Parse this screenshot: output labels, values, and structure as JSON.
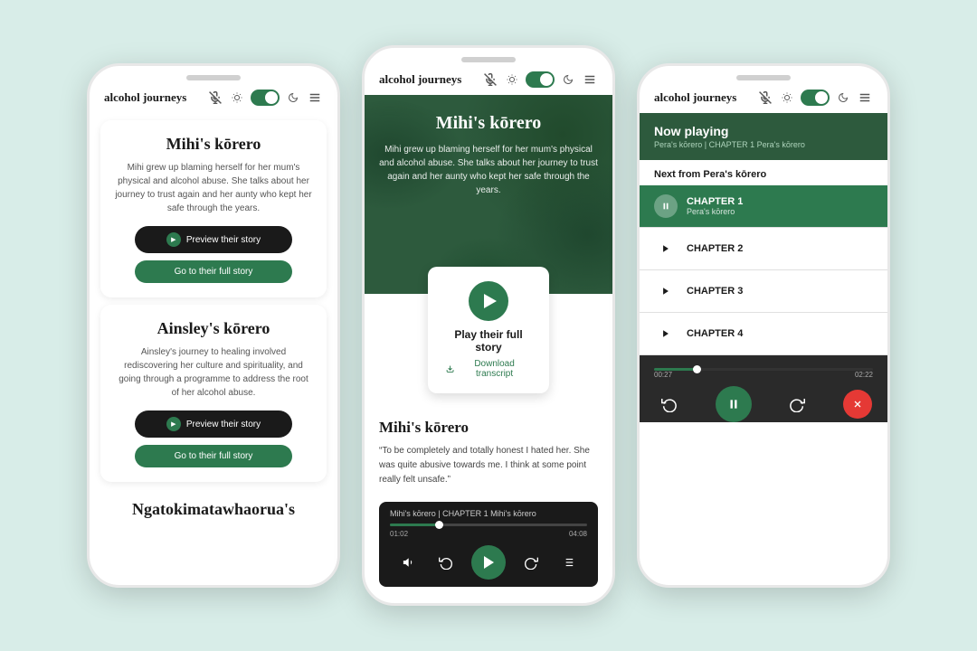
{
  "app": {
    "brand": "alcohol\njourneys",
    "toggle_on": true
  },
  "phone1": {
    "header": {
      "brand": "alcohol\njourneys"
    },
    "cards": [
      {
        "title": "Mihi's kōrero",
        "description": "Mihi grew up blaming herself for her mum's physical and alcohol abuse. She talks about her journey to trust again and her aunty who kept her safe through the years.",
        "btn_preview": "Preview their story",
        "btn_full": "Go to their full story"
      },
      {
        "title": "Ainsley's kōrero",
        "description": "Ainsley's journey to healing involved rediscovering her culture and spirituality, and going through a programme to address the root of her alcohol abuse.",
        "btn_preview": "Preview their story",
        "btn_full": "Go to their full story"
      }
    ],
    "partial_title": "Ngatokimatawhaorua's"
  },
  "phone2": {
    "header": {
      "brand": "alcohol\njourneys"
    },
    "hero": {
      "title": "Mihi's kōrero",
      "description": "Mihi grew up blaming herself for her mum's physical and alcohol abuse. She talks about her journey to trust again and her aunty who kept her safe through the years."
    },
    "play_card": {
      "title": "Play their full story",
      "download": "Download transcript"
    },
    "section": {
      "title": "Mihi's kōrero",
      "quote": "“To be completely and totally honest I hated her. She was quite abusive towards me. I think at some point really felt unsafe.”"
    },
    "player": {
      "track": "Mihi's kōrero | CHAPTER 1 Mihi's kōrero",
      "time_current": "01:02",
      "time_total": "04:08",
      "progress_pct": 25
    }
  },
  "phone3": {
    "header": {
      "brand": "alcohol\njourneys"
    },
    "now_playing": {
      "label": "Now playing",
      "track": "Pera's kōrero | CHAPTER 1 Pera's kōrero"
    },
    "next_label": "Next from Pera's kōrero",
    "chapters": [
      {
        "id": 1,
        "label": "CHAPTER 1",
        "sublabel": "Pera's kōrero",
        "active": true,
        "icon": "pause"
      },
      {
        "id": 2,
        "label": "CHAPTER 2",
        "sublabel": "",
        "active": false,
        "icon": "play"
      },
      {
        "id": 3,
        "label": "CHAPTER 3",
        "sublabel": "",
        "active": false,
        "icon": "play"
      },
      {
        "id": 4,
        "label": "CHAPTER 4",
        "sublabel": "",
        "active": false,
        "icon": "play"
      }
    ],
    "player": {
      "time_current": "00:27",
      "time_total": "02:22",
      "progress_pct": 20
    }
  }
}
